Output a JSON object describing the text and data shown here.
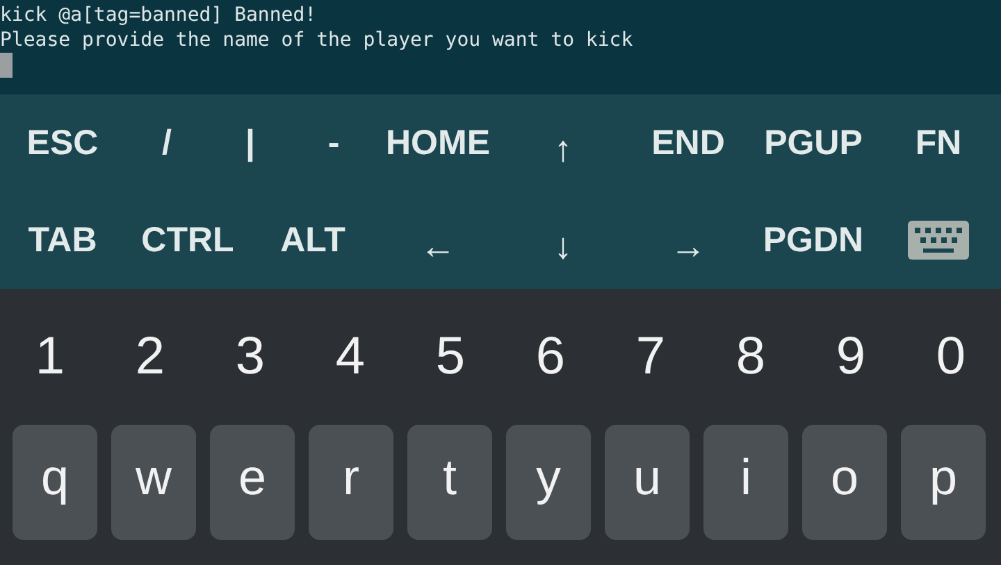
{
  "terminal": {
    "lines": [
      "kick @a[tag=banned] Banned!",
      "Please provide the name of the player you want to kick"
    ]
  },
  "extra_keys": {
    "top_row": [
      {
        "kind": "text",
        "label": "ESC"
      },
      {
        "kind": "symbol",
        "label": "/"
      },
      {
        "kind": "symbol",
        "label": "|"
      },
      {
        "kind": "symbol",
        "label": "-"
      },
      {
        "kind": "text",
        "label": "HOME"
      },
      {
        "kind": "arrow",
        "label": "↑"
      },
      {
        "kind": "text",
        "label": "END"
      },
      {
        "kind": "text",
        "label": "PGUP"
      },
      {
        "kind": "text",
        "label": "FN"
      }
    ],
    "bottom_row": [
      {
        "kind": "text",
        "label": "TAB"
      },
      {
        "kind": "text",
        "label": "CTRL"
      },
      {
        "kind": "text",
        "label": "ALT"
      },
      {
        "kind": "arrow",
        "label": "←"
      },
      {
        "kind": "arrow",
        "label": "↓"
      },
      {
        "kind": "arrow",
        "label": "→"
      },
      {
        "kind": "text",
        "label": "PGDN"
      },
      {
        "kind": "keyboard"
      }
    ]
  },
  "keyboard": {
    "number_row": [
      "1",
      "2",
      "3",
      "4",
      "5",
      "6",
      "7",
      "8",
      "9",
      "0"
    ],
    "letter_row": [
      "q",
      "w",
      "e",
      "r",
      "t",
      "y",
      "u",
      "i",
      "o",
      "p"
    ]
  }
}
